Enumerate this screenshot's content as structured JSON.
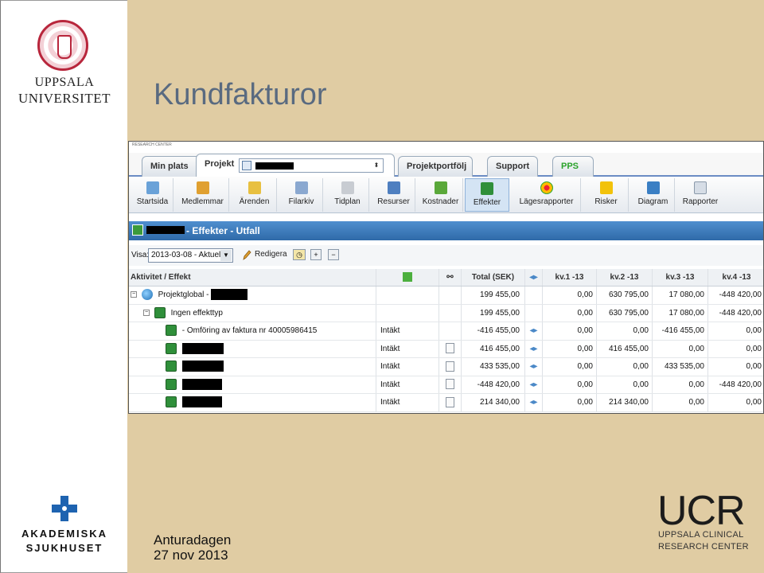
{
  "slide": {
    "title": "Kundfakturor",
    "footer_event": "Anturadagen",
    "footer_date": "27 nov 2013"
  },
  "logos": {
    "uu_line1": "UPPSALA",
    "uu_line2": "UNIVERSITET",
    "akad_line1": "AKADEMISKA",
    "akad_line2": "SJUKHUSET",
    "ucr_big": "UCR",
    "ucr_line1": "UPPSALA CLINICAL",
    "ucr_line2": "RESEARCH CENTER"
  },
  "app": {
    "top_strip": "RESEARCH CENTER",
    "tabs": [
      "Min plats",
      "Projekt",
      "Projektportfölj",
      "Support",
      "PPS"
    ],
    "toolbar": [
      "Startsida",
      "Medlemmar",
      "Ärenden",
      "Filarkiv",
      "Tidplan",
      "Resurser",
      "Kostnader",
      "Effekter",
      "Lägesrapporter",
      "Risker",
      "Diagram",
      "Rapporter"
    ],
    "toolbar_active": "Effekter",
    "section_header": "- Effekter - Utfall",
    "visa_label": "Visa:",
    "visa_value": "2013-03-08 - Aktuell",
    "edit_label": "Redigera"
  },
  "table": {
    "headers": {
      "activity": "Aktivitet / Effekt",
      "total": "Total (SEK)",
      "kv1": "kv.1 -13",
      "kv2": "kv.2 -13",
      "kv3": "kv.3 -13",
      "kv4": "kv.4 -13"
    },
    "rows": [
      {
        "label": "Projektglobal -",
        "type": "",
        "total": "199 455,00",
        "kv1": "0,00",
        "kv2": "630 795,00",
        "kv3": "17 080,00",
        "kv4": "-448 420,00"
      },
      {
        "label": "Ingen effekttyp",
        "type": "",
        "total": "199 455,00",
        "kv1": "0,00",
        "kv2": "630 795,00",
        "kv3": "17 080,00",
        "kv4": "-448 420,00"
      },
      {
        "label": "- Omföring av faktura nr 40005986415",
        "type": "Intäkt",
        "total": "-416 455,00",
        "kv1": "0,00",
        "kv2": "0,00",
        "kv3": "-416 455,00",
        "kv4": "0,00"
      },
      {
        "label": "",
        "type": "Intäkt",
        "total": "416 455,00",
        "kv1": "0,00",
        "kv2": "416 455,00",
        "kv3": "0,00",
        "kv4": "0,00"
      },
      {
        "label": "",
        "type": "Intäkt",
        "total": "433 535,00",
        "kv1": "0,00",
        "kv2": "0,00",
        "kv3": "433 535,00",
        "kv4": "0,00"
      },
      {
        "label": "",
        "type": "Intäkt",
        "total": "-448 420,00",
        "kv1": "0,00",
        "kv2": "0,00",
        "kv3": "0,00",
        "kv4": "-448 420,00"
      },
      {
        "label": "",
        "type": "Intäkt",
        "total": "214 340,00",
        "kv1": "0,00",
        "kv2": "214 340,00",
        "kv3": "0,00",
        "kv4": "0,00"
      }
    ]
  },
  "colors": {
    "slide_bg": "#e0cca3",
    "title": "#596a80",
    "header_blue": "#3a78b8",
    "uu_red": "#b8263c",
    "akad_blue": "#1e63b0"
  }
}
